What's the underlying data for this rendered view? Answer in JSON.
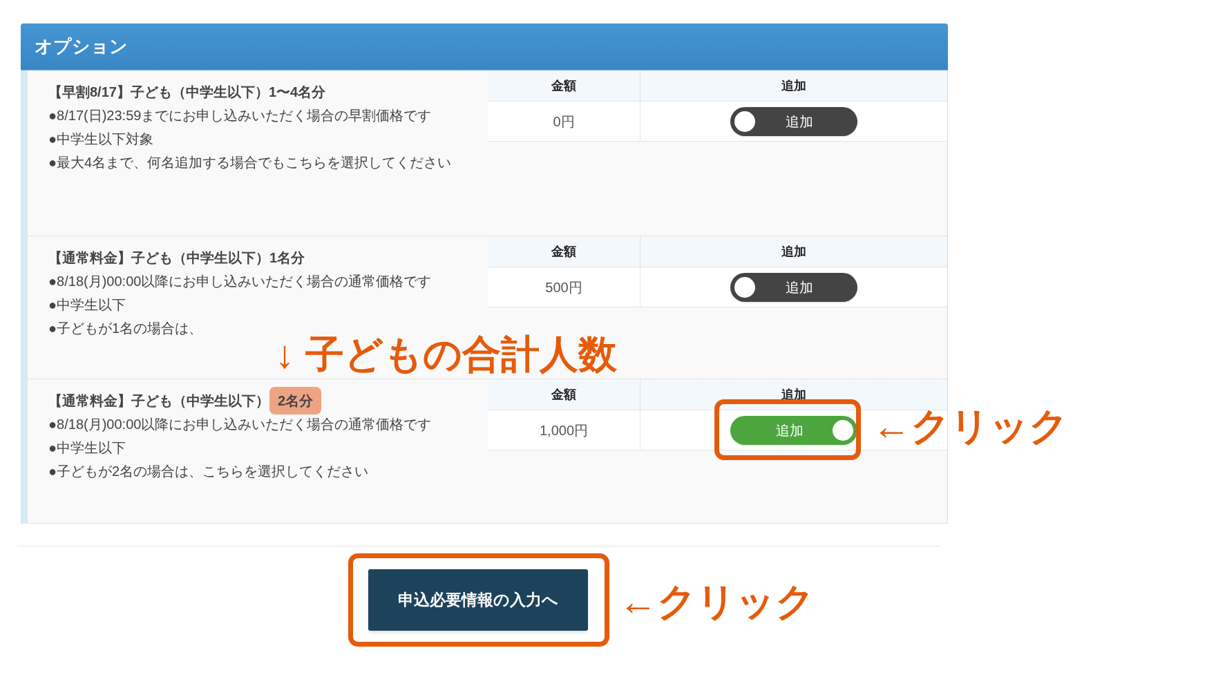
{
  "panel": {
    "title": "オプション"
  },
  "options": [
    {
      "title": "【早割8/17】子ども（中学生以下）1〜4名分",
      "lines": [
        "●8/17(日)23:59までにお申し込みいただく場合の早割価格です",
        "●中学生以下対象",
        "●最大4名まで、何名追加する場合でもこちらを選択してください"
      ],
      "price_header": "金額",
      "add_header": "追加",
      "price": "0円",
      "toggle": {
        "label": "追加",
        "on": false
      }
    },
    {
      "title": "【通常料金】子ども（中学生以下）1名分",
      "lines": [
        "●8/18(月)00:00以降にお申し込みいただく場合の通常価格です",
        "●中学生以下",
        "●子どもが1名の場合は、"
      ],
      "price_header": "金額",
      "add_header": "追加",
      "price": "500円",
      "toggle": {
        "label": "追加",
        "on": false
      }
    },
    {
      "title": "【通常料金】子ども（中学生以下）",
      "title_badge": "2名分",
      "lines": [
        "●8/18(月)00:00以降にお申し込みいただく場合の通常価格です",
        "●中学生以下",
        "●子どもが2名の場合は、こちらを選択してください"
      ],
      "price_header": "金額",
      "add_header": "追加",
      "price": "1,000円",
      "toggle": {
        "label": "追加",
        "on": true
      }
    }
  ],
  "submit_button": "申込必要情報の入力へ",
  "annotations": [
    {
      "kind": "note",
      "text": "↓ 子どもの合計人数"
    },
    {
      "kind": "toggle_callout",
      "text": "←クリック"
    },
    {
      "kind": "button_callout",
      "text": "←クリック"
    }
  ]
}
